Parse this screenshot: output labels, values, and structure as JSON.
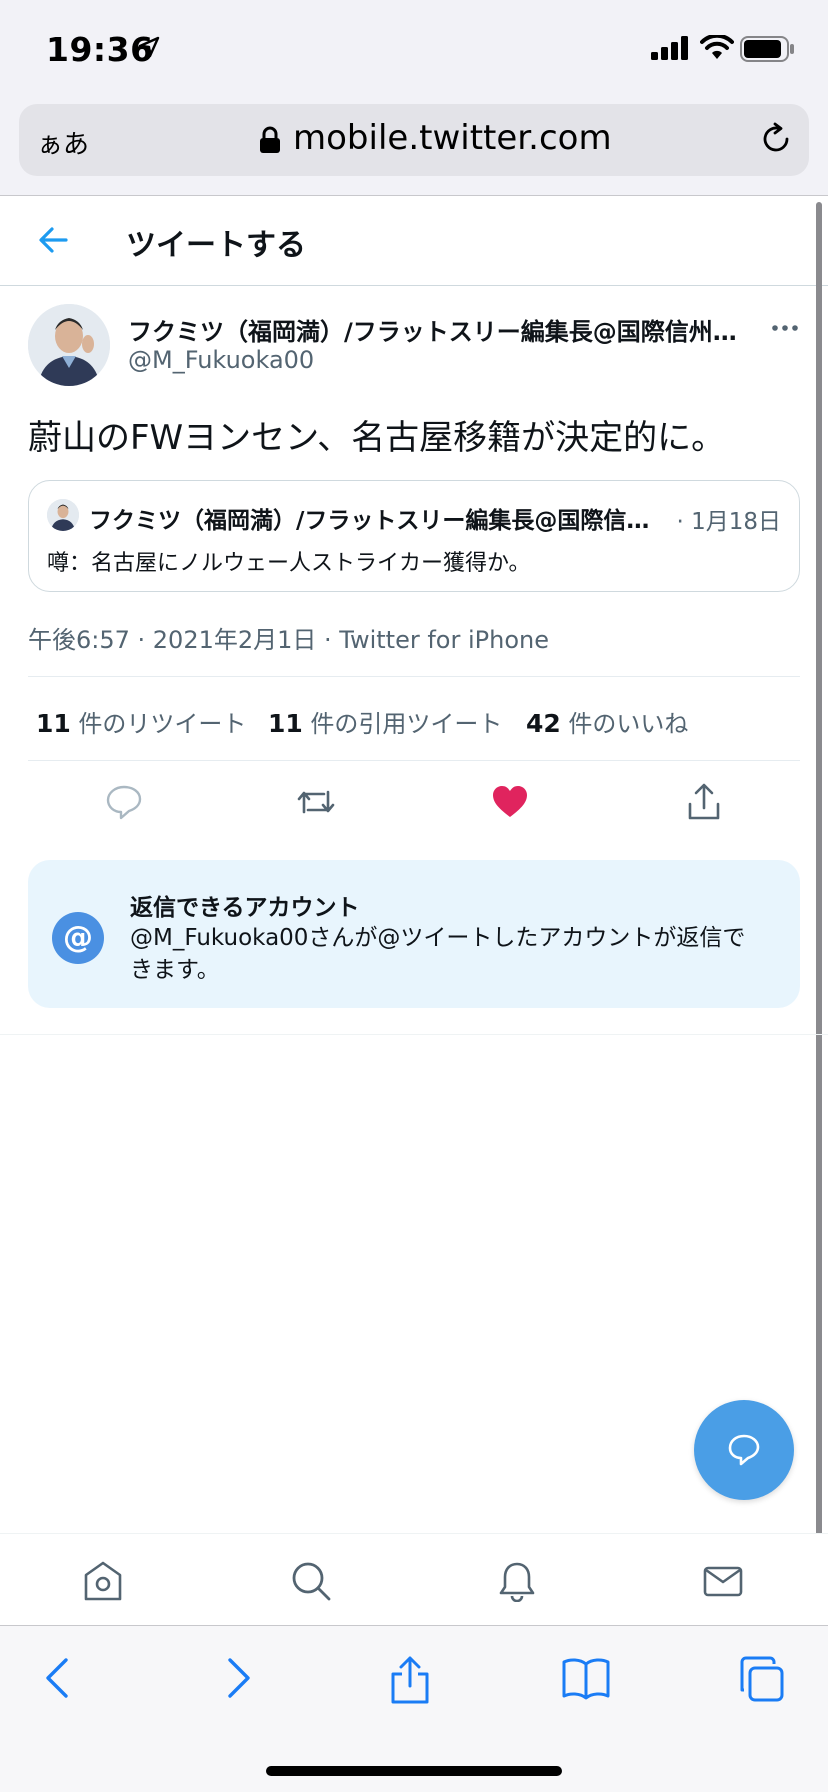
{
  "status_bar": {
    "time": "19:36"
  },
  "browser": {
    "text_size_label": "ぁあ",
    "url": "mobile.twitter.com"
  },
  "header": {
    "title": "ツイートする"
  },
  "tweet": {
    "author_name": "フクミツ（福岡満）/フラットスリー編集長@国際信州…",
    "author_handle": "@M_Fukuoka00",
    "text": "蔚山のFWヨンセン、名古屋移籍が決定的に。",
    "quote": {
      "author_name": "フクミツ（福岡満）/フラットスリー編集長@国際信…",
      "date": "· 1月18日",
      "text": "噂：名古屋にノルウェー人ストライカー獲得か。"
    },
    "meta": "午後6:57 · 2021年2月1日 · Twitter for iPhone",
    "stats": {
      "retweets_count": "11",
      "retweets_label": " 件のリツイート",
      "quotes_count": "11",
      "quotes_label": " 件の引用ツイート",
      "likes_count": "42",
      "likes_label": " 件のいいね"
    },
    "liked": true
  },
  "reply_restriction": {
    "icon": "@",
    "title": "返信できるアカウント",
    "description": "@M_Fukuoka00さんが@ツイートしたアカウントが返信できます。"
  },
  "colors": {
    "accent": "#1d9bf0",
    "like": "#e0245e",
    "text": "#0f1419",
    "muted": "#536471"
  },
  "nav_icons": [
    "home-icon",
    "search-icon",
    "bell-icon",
    "mail-icon"
  ],
  "safari_icons": [
    "back-icon",
    "forward-icon",
    "share-icon",
    "bookmarks-icon",
    "tabs-icon"
  ]
}
